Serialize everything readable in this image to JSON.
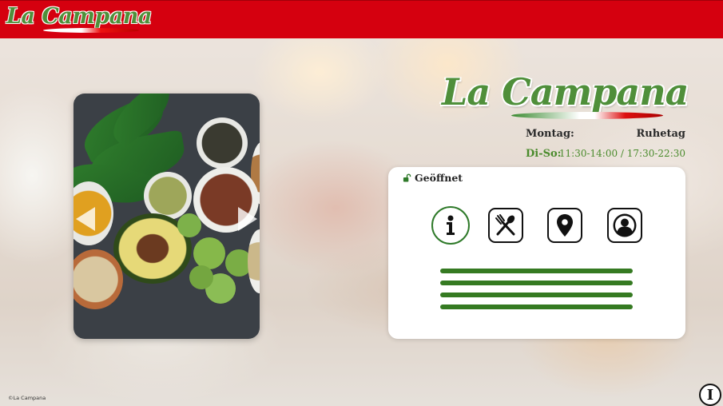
{
  "header": {
    "logo_text": "La Campana",
    "background_color": "#d5000f"
  },
  "carousel": {
    "image_icon": "food-bowls-image",
    "prev_icon": "chevron-left-icon",
    "next_icon": "chevron-right-icon"
  },
  "brand": {
    "logo_text": "La Campana",
    "accent_color": "#4f8f3a"
  },
  "hours": [
    {
      "day": "Montag:",
      "time": "Ruhetag"
    },
    {
      "day": "Di-So:",
      "time": "11:30-14:00 / 17:30-22:30"
    }
  ],
  "card": {
    "status_icon": "unlock-icon",
    "status_text": "Geöffnet",
    "tabs": [
      {
        "icon": "info-icon",
        "active": true
      },
      {
        "icon": "cutlery-icon",
        "active": false
      },
      {
        "icon": "location-pin-icon",
        "active": false
      },
      {
        "icon": "contact-person-icon",
        "active": false
      }
    ],
    "content_line_color": "#357a22"
  },
  "footer": {
    "copyright": "©La Campana",
    "fab_label": "I"
  }
}
